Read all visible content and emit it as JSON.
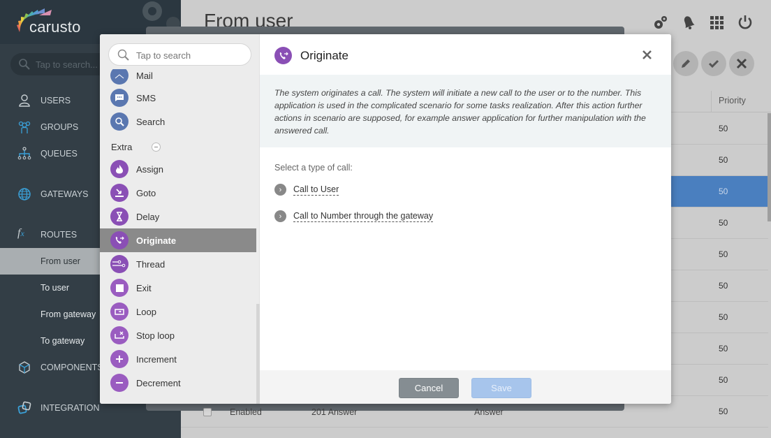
{
  "app": {
    "logo_text": "carusto",
    "sidebar_search_placeholder": "Tap to search..."
  },
  "sidebar": {
    "items": [
      {
        "label": "USERS",
        "icon": "user-icon"
      },
      {
        "label": "GROUPS",
        "icon": "group-icon"
      },
      {
        "label": "QUEUES",
        "icon": "queue-icon"
      },
      {
        "label": "GATEWAYS",
        "icon": "globe-icon"
      },
      {
        "label": "ROUTES",
        "icon": "fx-icon"
      },
      {
        "label": "COMPONENTS",
        "icon": "cube-icon"
      },
      {
        "label": "INTEGRATION",
        "icon": "integration-icon"
      }
    ],
    "routes_sub": [
      {
        "label": "From user",
        "active": true
      },
      {
        "label": "To user"
      },
      {
        "label": "From gateway"
      },
      {
        "label": "To gateway"
      }
    ]
  },
  "header": {
    "page_title": "From user",
    "icons": [
      "settings-gears-icon",
      "bell-icon",
      "apps-grid-icon",
      "power-icon"
    ],
    "actions": [
      "edit-icon",
      "check-icon",
      "close-icon"
    ]
  },
  "table": {
    "columns": [
      "Priority"
    ],
    "rows": [
      {
        "priority": "50"
      },
      {
        "priority": "50"
      },
      {
        "priority": "50",
        "selected": true
      },
      {
        "priority": "50"
      },
      {
        "priority": "50"
      },
      {
        "priority": "50"
      },
      {
        "priority": "50"
      },
      {
        "priority": "50"
      },
      {
        "priority": "50"
      },
      {
        "priority": "50",
        "status": "Enabled",
        "name": "201 Answer",
        "app": "Answer"
      }
    ]
  },
  "modal": {
    "palette": {
      "search_placeholder": "Tap to search",
      "items_top": [
        {
          "label": "Mail",
          "icon": "mail-icon"
        },
        {
          "label": "SMS",
          "icon": "sms-icon"
        },
        {
          "label": "Search",
          "icon": "search-icon"
        }
      ],
      "section": "Extra",
      "items_extra": [
        {
          "label": "Assign",
          "icon": "flame-icon"
        },
        {
          "label": "Goto",
          "icon": "goto-icon"
        },
        {
          "label": "Delay",
          "icon": "hourglass-icon"
        },
        {
          "label": "Originate",
          "icon": "phone-forward-icon",
          "active": true
        },
        {
          "label": "Thread",
          "icon": "thread-icon"
        },
        {
          "label": "Exit",
          "icon": "stop-icon"
        },
        {
          "label": "Loop",
          "icon": "loop-icon"
        },
        {
          "label": "Stop loop",
          "icon": "stop-loop-icon"
        },
        {
          "label": "Increment",
          "icon": "plus-icon"
        },
        {
          "label": "Decrement",
          "icon": "minus-icon"
        }
      ]
    },
    "title": "Originate",
    "description": "The system originates a call. The system will initiate a new call to the user or to the number. This application is used in the complicated scenario for some tasks realization. After this action further actions in scenario are supposed, for example answer application for further manipulation with the answered call.",
    "select_label": "Select a type of call:",
    "options": [
      "Call to User",
      "Call to Number through the gateway"
    ],
    "cancel_label": "Cancel",
    "save_label": "Save"
  }
}
